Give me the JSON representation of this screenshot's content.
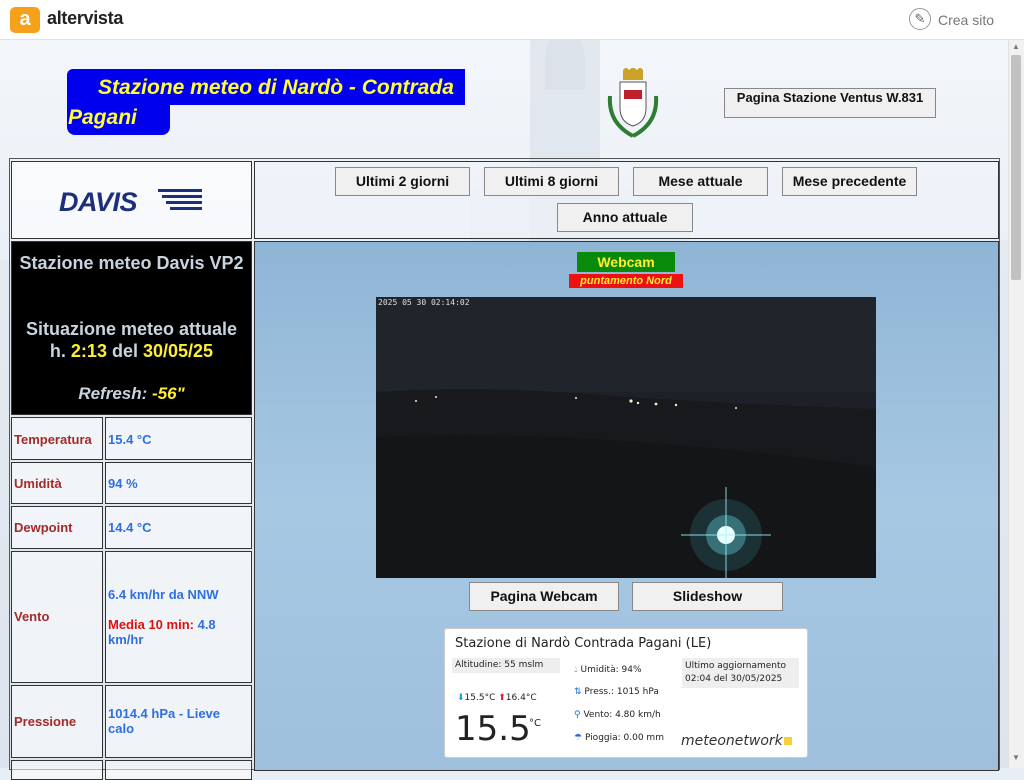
{
  "topbar": {
    "brand": "altervista",
    "logo_letter": "a",
    "crea_label": "Crea sito"
  },
  "header": {
    "title": "Stazione meteo di Nardò - Contrada Pagani",
    "ventus_button": "Pagina Stazione Ventus W.831"
  },
  "davis": {
    "logo": "DAVIS"
  },
  "nav_buttons": [
    "Ultimi 2 giorni",
    "Ultimi 8 giorni",
    "Mese attuale",
    "Mese precedente",
    "Anno attuale"
  ],
  "status": {
    "station": "Stazione meteo Davis VP2",
    "situation": "Situazione meteo attuale",
    "time_prefix": "h.",
    "time": "2:13",
    "date_prefix": "del",
    "date": "30/05/25",
    "refresh_label": "Refresh:",
    "refresh_value": "-56\""
  },
  "readings": {
    "temperatura": {
      "label": "Temperatura",
      "value": "15.4 °C"
    },
    "umidita": {
      "label": "Umidità",
      "value": "94 %"
    },
    "dewpoint": {
      "label": "Dewpoint",
      "value": "14.4 °C"
    },
    "vento": {
      "label": "Vento",
      "value": "6.4 km/hr da NNW",
      "media_label": "Media 10 min:",
      "media_value": "4.8 km/hr"
    },
    "pressione": {
      "label": "Pressione",
      "value": "1014.4 hPa - Lieve calo"
    }
  },
  "webcam": {
    "label": "Webcam",
    "sublabel": "puntamento Nord",
    "timestamp": "2025 05 30 02:14:02",
    "page_button": "Pagina Webcam",
    "slideshow_button": "Slideshow"
  },
  "meteonetwork": {
    "title": "Stazione di Nardò  Contrada Pagani (LE)",
    "altitude": "Altitudine: 55 mslm",
    "min": "15.5°C",
    "max": "16.4°C",
    "temp": "15.5",
    "temp_unit": "°C",
    "humidity": "Umidità: 94%",
    "pressure": "Press.: 1015 hPa",
    "wind": "Vento: 4.80 km/h",
    "rain": "Pioggia: 0.00 mm",
    "update_label": "Ultimo aggiornamento",
    "update_value": "02:04 del 30/05/2025",
    "brand": "meteonetwork"
  },
  "colors": {
    "title_bg": "#0000ee",
    "title_text": "#ffff33",
    "webcam_green": "#0a8a0a",
    "alert_red": "#ee1111"
  }
}
